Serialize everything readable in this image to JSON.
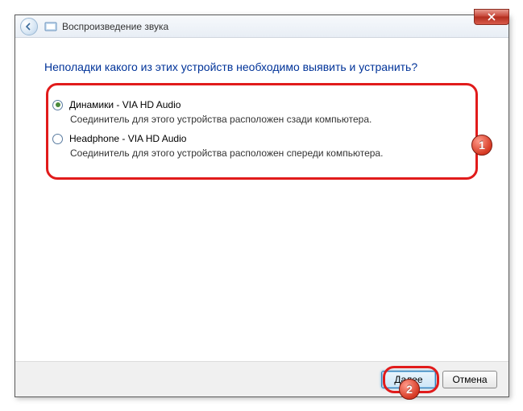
{
  "titlebar": {
    "title": "Воспроизведение звука"
  },
  "content": {
    "heading": "Неполадки какого из этих устройств необходимо выявить и устранить?",
    "options": [
      {
        "label": "Динамики - VIA HD Audio",
        "description": "Соединитель для этого устройства расположен сзади компьютера.",
        "checked": true
      },
      {
        "label": "Headphone - VIA HD Audio",
        "description": "Соединитель для этого устройства расположен спереди компьютера.",
        "checked": false
      }
    ]
  },
  "footer": {
    "next": "Далее",
    "cancel": "Отмена"
  },
  "markers": {
    "one": "1",
    "two": "2"
  }
}
